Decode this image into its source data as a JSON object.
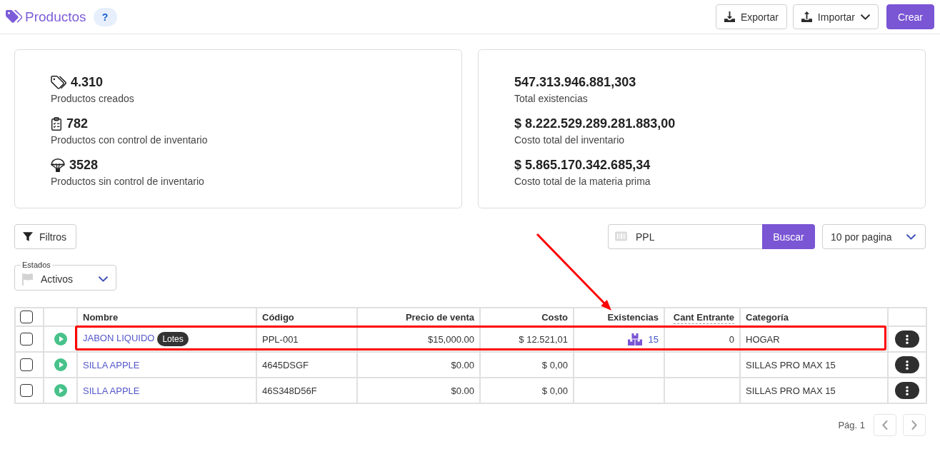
{
  "header": {
    "title": "Productos",
    "help": "?",
    "buttons": [
      {
        "kind": "export",
        "label": "Exportar"
      },
      {
        "kind": "import",
        "label": "Importar"
      },
      {
        "kind": "create",
        "label": "Crear"
      }
    ]
  },
  "summary_cards": [
    {
      "stats": [
        {
          "kind": "tags",
          "value": "4.310",
          "label": "Productos creados"
        },
        {
          "kind": "clipboard",
          "value": "782",
          "label": "Productos con control de inventario"
        },
        {
          "kind": "parachute",
          "value": "3528",
          "label": "Productos sin control de inventario"
        }
      ]
    },
    {
      "stats": [
        {
          "kind": "plain",
          "value": "547.313.946.881,303",
          "label": "Total existencias"
        },
        {
          "kind": "plain",
          "value": "$ 8.222.529.289.281.883,00",
          "label": "Costo total del inventario"
        },
        {
          "kind": "plain",
          "value": "$ 5.865.170.342.685,34",
          "label": "Costo total de la materia prima"
        }
      ]
    }
  ],
  "toolbar": {
    "filter_button": "Filtros",
    "search": {
      "value": "PPL",
      "button": "Buscar"
    },
    "page_size": "10 por pagina"
  },
  "status_filter": {
    "legend": "Estados",
    "value": "Activos"
  },
  "table": {
    "select_all": {
      "checked": false
    },
    "columns": [
      {
        "kind": "text",
        "label": "Nombre",
        "hint": false,
        "pointed": false
      },
      {
        "kind": "text",
        "label": "Código",
        "hint": false,
        "pointed": false
      },
      {
        "kind": "number",
        "label": "Precio de venta",
        "hint": false,
        "pointed": false
      },
      {
        "kind": "number",
        "label": "Costo",
        "hint": false,
        "pointed": false
      },
      {
        "kind": "number",
        "label": "Existencias",
        "hint": false,
        "pointed": true
      },
      {
        "kind": "number",
        "label": "Cant Entrante",
        "hint": true,
        "pointed": false
      },
      {
        "kind": "text",
        "label": "Categoría",
        "hint": false,
        "pointed": false
      }
    ],
    "rows": [
      {
        "checked": false,
        "active": true,
        "highlighted": true,
        "cells": [
          {
            "kind": "link",
            "text": "JABON LIQUIDO",
            "badge": "Lotes"
          },
          {
            "kind": "text",
            "text": "PPL-001"
          },
          {
            "kind": "text",
            "text": "$15,000.00"
          },
          {
            "kind": "text",
            "text": "$ 12.521,01"
          },
          {
            "kind": "stock",
            "text": "15"
          },
          {
            "kind": "text",
            "text": "0"
          },
          {
            "kind": "text",
            "text": "HOGAR"
          }
        ]
      },
      {
        "checked": false,
        "active": true,
        "highlighted": false,
        "cells": [
          {
            "kind": "link",
            "text": "SILLA APPLE"
          },
          {
            "kind": "text",
            "text": "4645DSGF"
          },
          {
            "kind": "text",
            "text": "$0.00"
          },
          {
            "kind": "text",
            "text": "$ 0,00"
          },
          null,
          null,
          {
            "kind": "text",
            "text": "SILLAS PRO MAX 15"
          }
        ]
      },
      {
        "checked": false,
        "active": true,
        "highlighted": false,
        "cells": [
          {
            "kind": "link",
            "text": "SILLA APPLE"
          },
          {
            "kind": "text",
            "text": "46S348D56F"
          },
          {
            "kind": "text",
            "text": "$0.00"
          },
          {
            "kind": "text",
            "text": "$ 0,00"
          },
          null,
          null,
          {
            "kind": "text",
            "text": "SILLAS PRO MAX 15"
          }
        ]
      }
    ]
  },
  "pagination": {
    "label": "Pág. 1"
  }
}
